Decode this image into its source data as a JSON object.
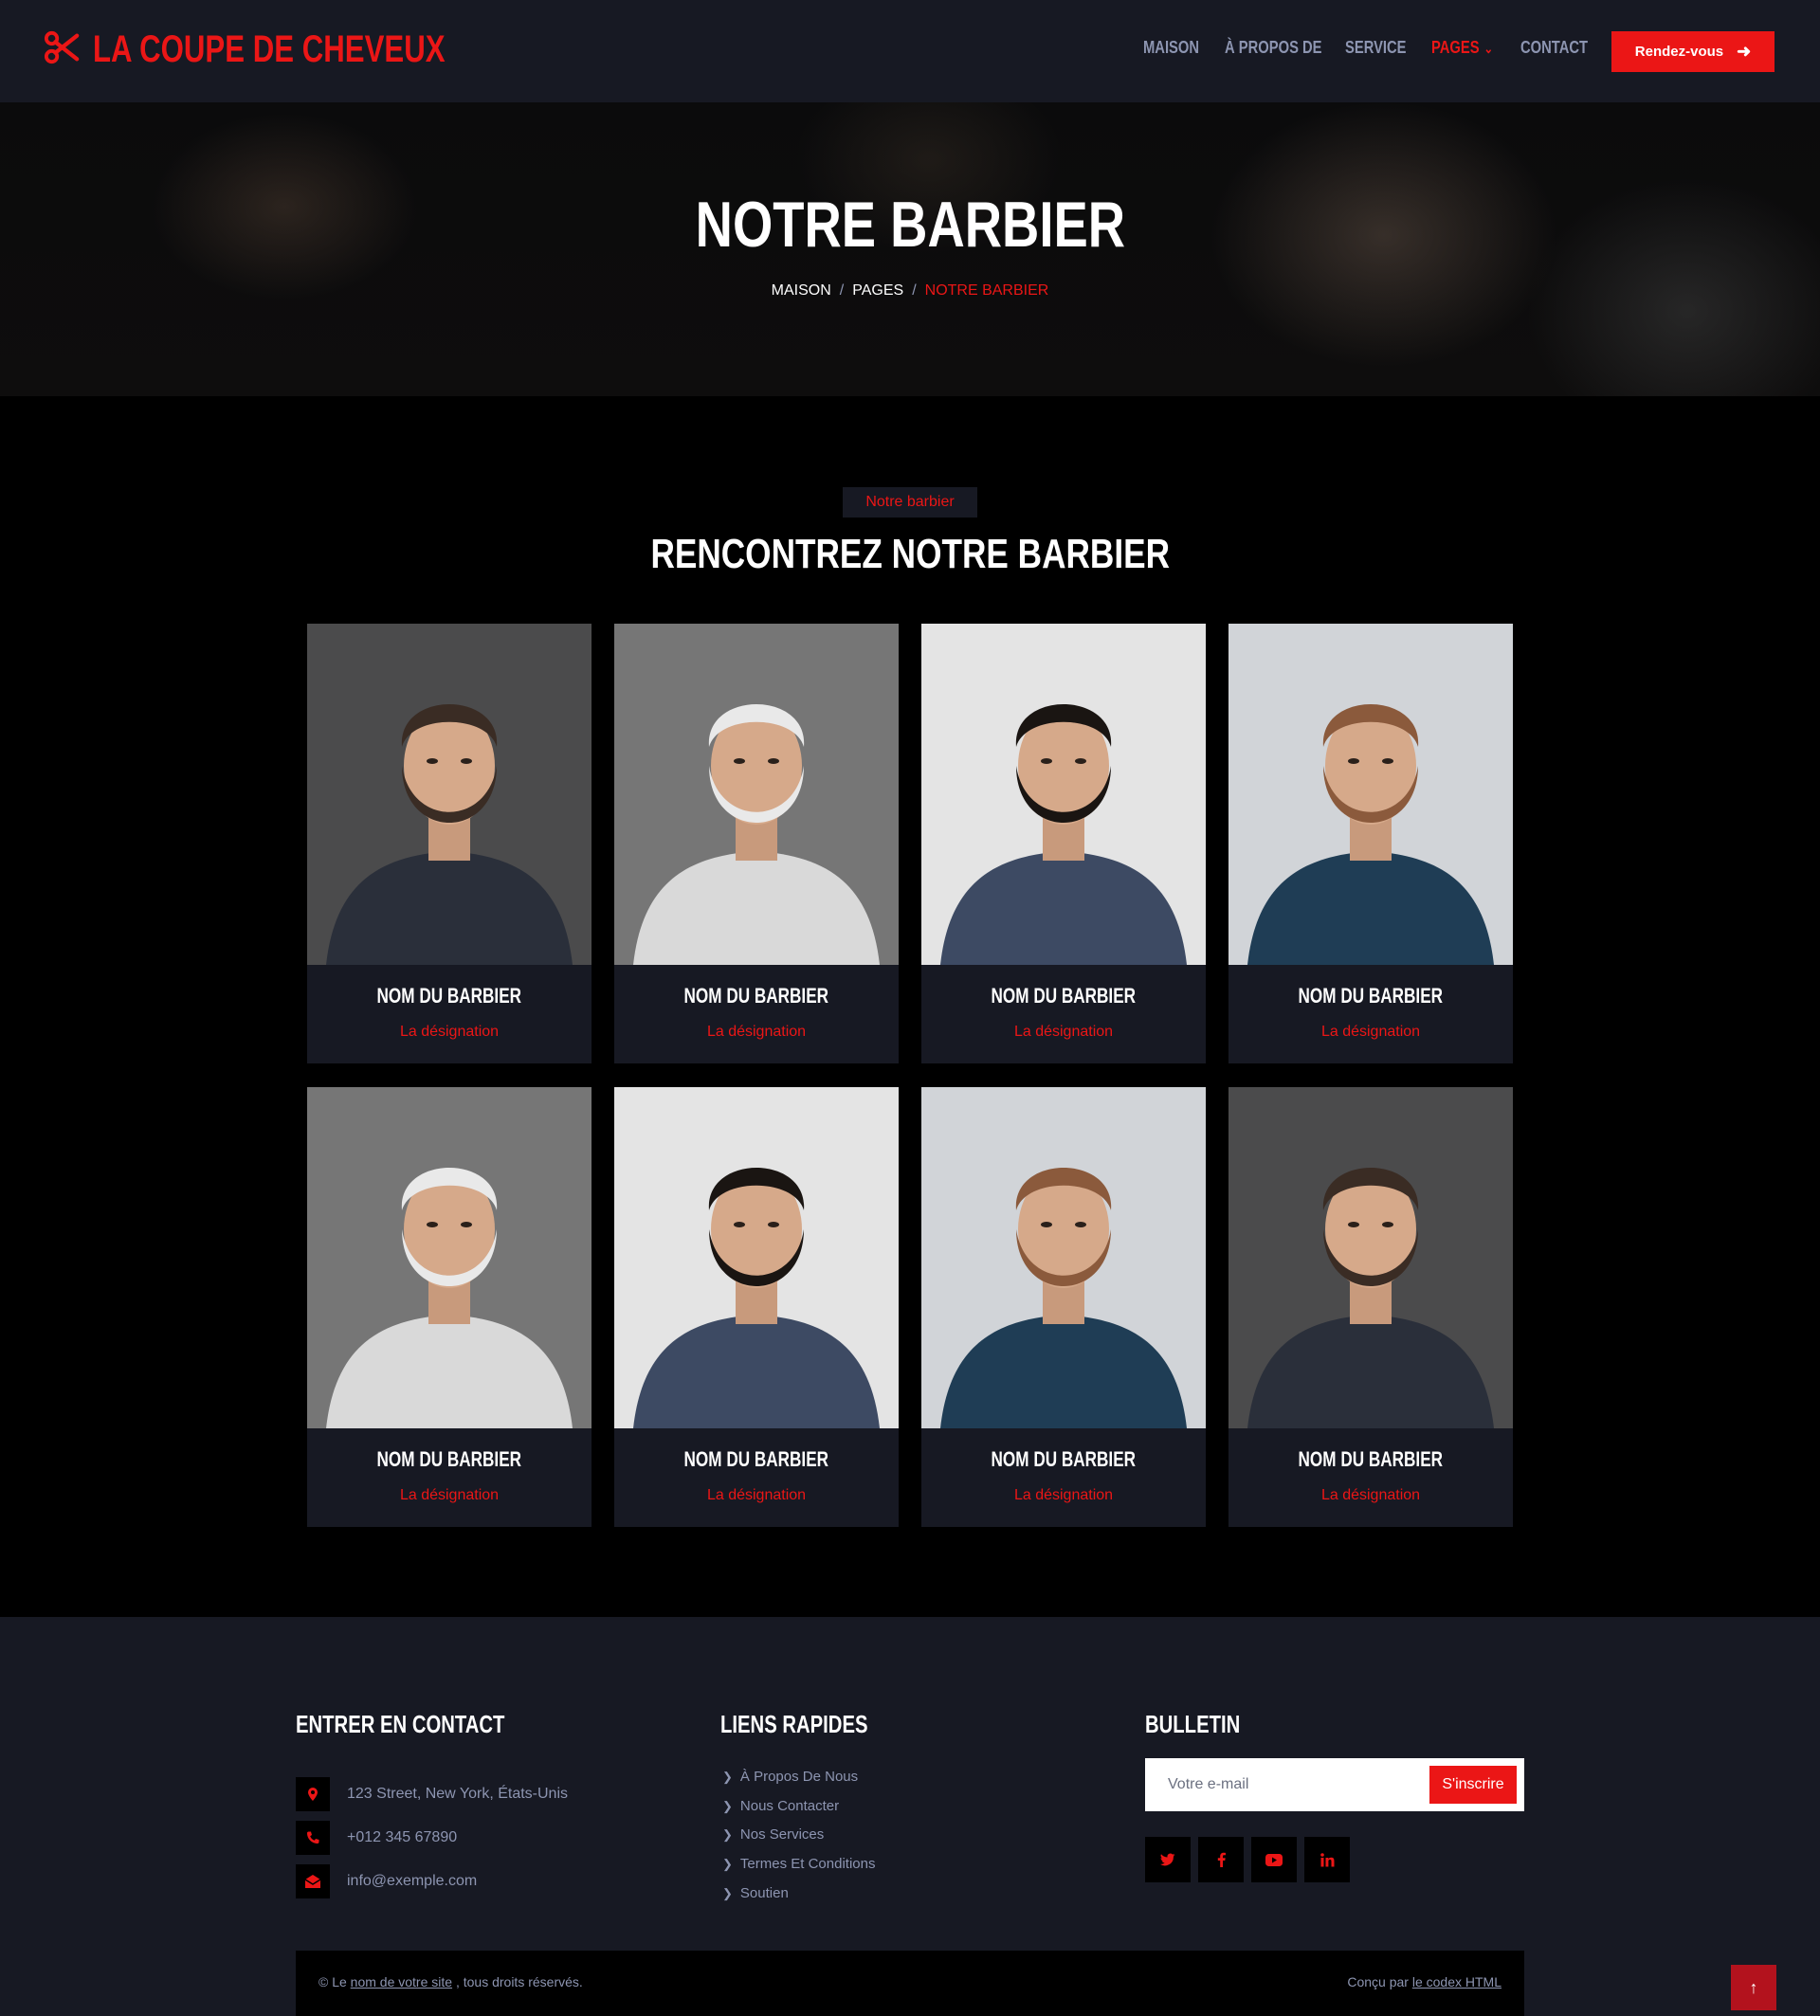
{
  "brand": {
    "name": "LA COUPE DE CHEVEUX",
    "accent": "#eb1616",
    "dark": "#171923",
    "muted": "#8d95b1",
    "logo_icon": "scissors-icon"
  },
  "nav": {
    "links": [
      "MAISON",
      "À PROPOS DE",
      "SERVICE",
      "PAGES",
      "CONTACT"
    ],
    "active": "PAGES",
    "cta_label": "Rendez-vous"
  },
  "hero": {
    "title": "NOTRE BARBIER",
    "breadcrumb": [
      "MAISON",
      "PAGES",
      "NOTRE BARBIER"
    ]
  },
  "team": {
    "badge": "Notre barbier",
    "title": "RENCONTREZ NOTRE BARBIER",
    "members": [
      {
        "name": "NOM DU BARBIER",
        "role": "La désignation"
      },
      {
        "name": "NOM DU BARBIER",
        "role": "La désignation"
      },
      {
        "name": "NOM DU BARBIER",
        "role": "La désignation"
      },
      {
        "name": "NOM DU BARBIER",
        "role": "La désignation"
      },
      {
        "name": "NOM DU BARBIER",
        "role": "La désignation"
      },
      {
        "name": "NOM DU BARBIER",
        "role": "La désignation"
      },
      {
        "name": "NOM DU BARBIER",
        "role": "La désignation"
      },
      {
        "name": "NOM DU BARBIER",
        "role": "La désignation"
      }
    ]
  },
  "footer": {
    "contact": {
      "heading": "ENTRER EN CONTACT",
      "address": "123 Street, New York, États-Unis",
      "phone": "+012 345 67890",
      "email": "info@exemple.com"
    },
    "quick_links": {
      "heading": "LIENS RAPIDES",
      "items": [
        "À Propos De Nous",
        "Nous Contacter",
        "Nos Services",
        "Termes Et Conditions",
        "Soutien"
      ]
    },
    "newsletter": {
      "heading": "BULLETIN",
      "placeholder": "Votre e-mail",
      "button": "S'inscrire",
      "socials": [
        "twitter-icon",
        "facebook-icon",
        "youtube-icon",
        "linkedin-icon"
      ]
    },
    "copyright": {
      "prefix": "© Le",
      "site_link": "nom de votre site",
      "suffix": ", tous droits réservés.",
      "designed_by": "Conçu par",
      "designer_link": "le codex HTML"
    }
  }
}
